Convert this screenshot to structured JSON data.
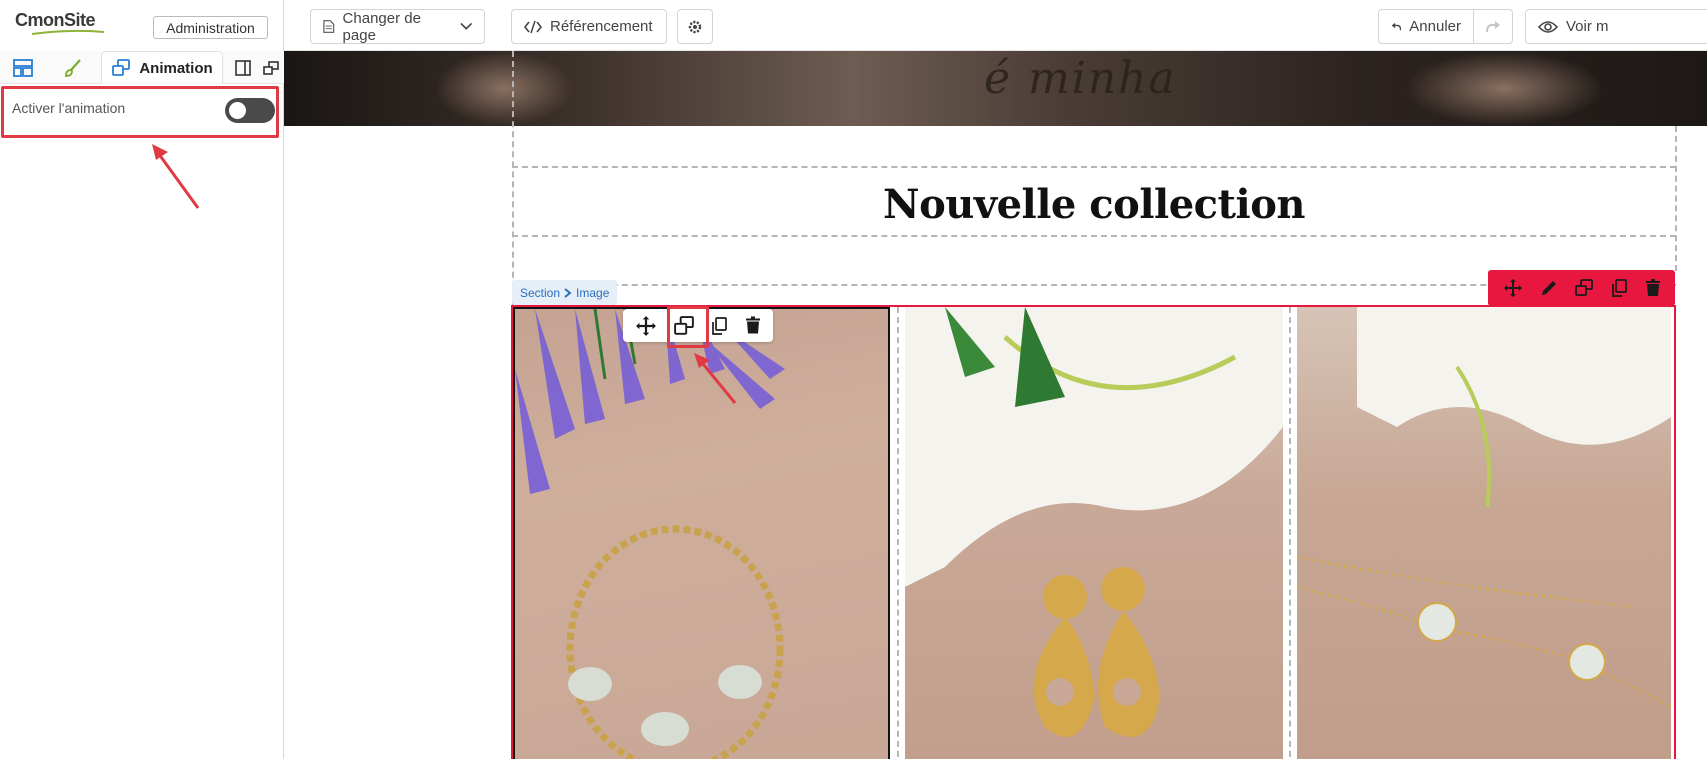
{
  "sidebar": {
    "logo": {
      "part1": "C",
      "part2": "mon",
      "part3": "Site"
    },
    "admin_button": "Administration",
    "tabs": [
      {
        "name": "layout",
        "icon": "layout-icon"
      },
      {
        "name": "style",
        "icon": "brush-icon"
      },
      {
        "name": "animation",
        "icon": "animation-icon",
        "label": "Animation",
        "active": true
      },
      {
        "name": "panel",
        "icon": "panel-icon"
      },
      {
        "name": "detach",
        "icon": "detach-icon"
      }
    ],
    "animation_toggle": {
      "label": "Activer l'animation",
      "enabled": false
    }
  },
  "toolbar": {
    "change_page": "Changer de page",
    "seo": "Référencement",
    "undo": "Annuler",
    "view": "Voir m"
  },
  "canvas": {
    "hero_text": "é minha",
    "title": "Nouvelle collection",
    "breadcrumb": {
      "section": "Section",
      "item": "Image"
    }
  },
  "colors": {
    "accent_red": "#e8173f",
    "highlight_red": "#e03a45",
    "link_blue": "#2a6fbf"
  }
}
